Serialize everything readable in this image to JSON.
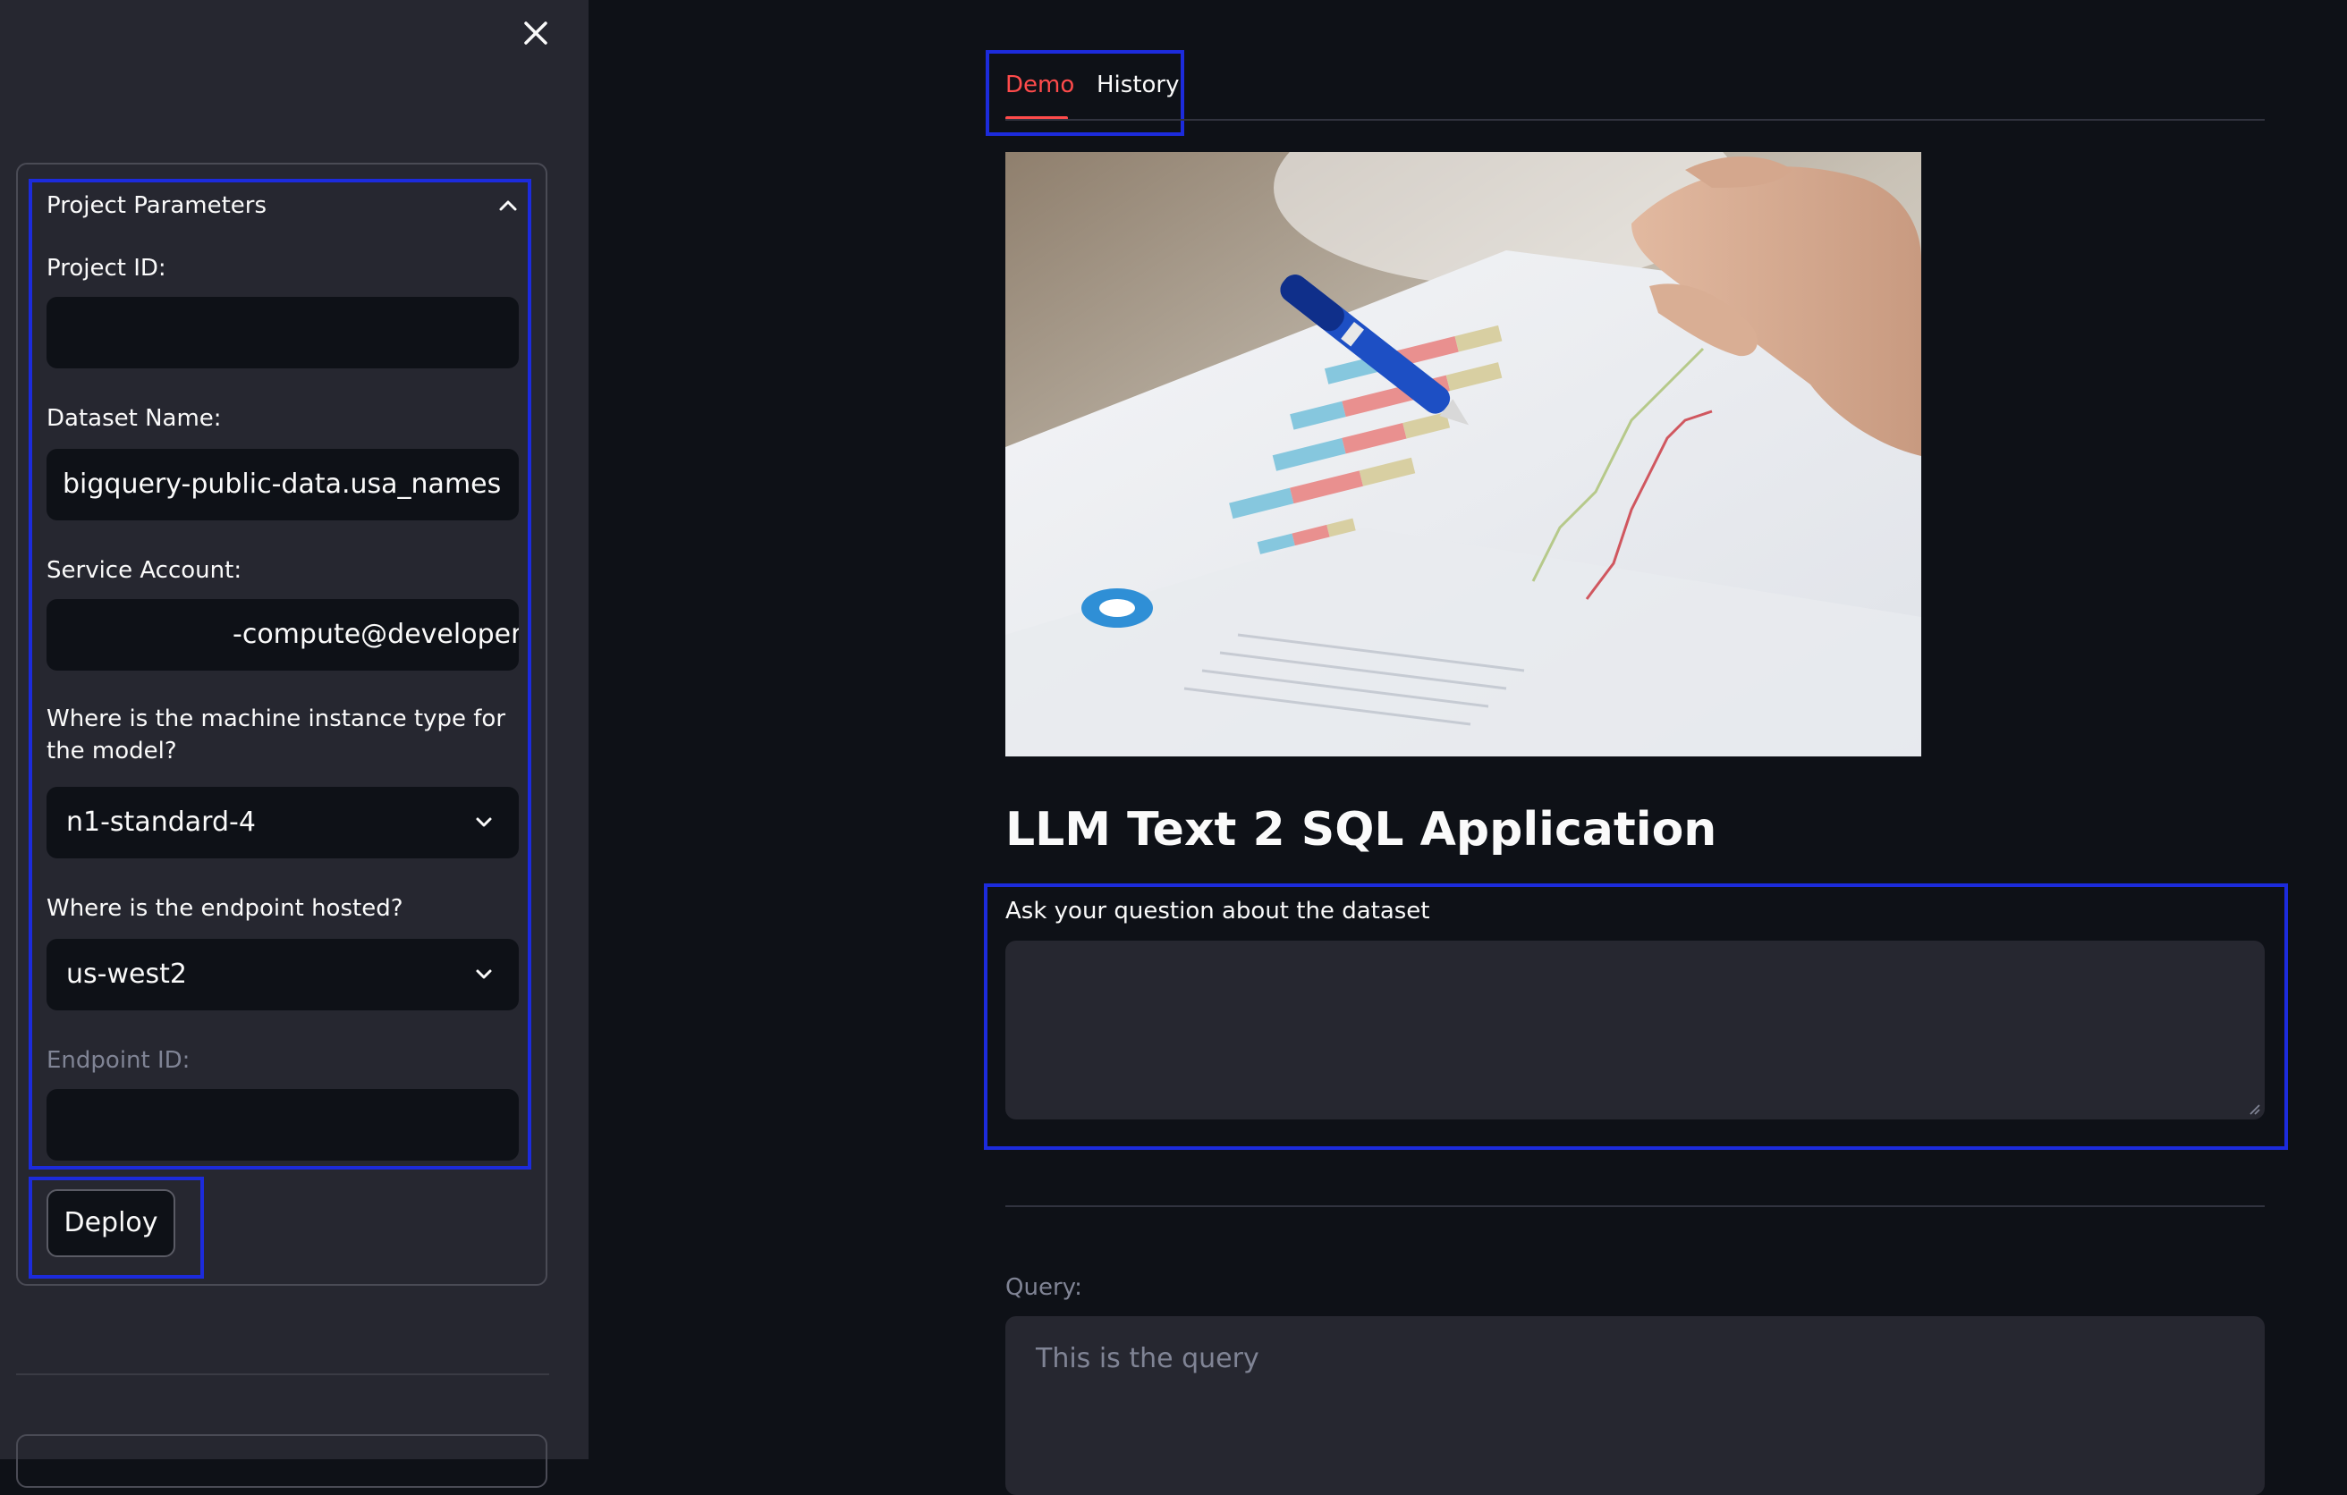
{
  "sidebar": {
    "expander_title": "Project Parameters",
    "project_id": {
      "label": "Project ID:",
      "value": ""
    },
    "dataset_name": {
      "label": "Dataset Name:",
      "value": "bigquery-public-data.usa_names"
    },
    "service_account": {
      "label": "Service Account:",
      "value": "-compute@developer.gserviceaccount.com"
    },
    "machine_type": {
      "label": "Where is the machine instance type for the model?",
      "value": "n1-standard-4"
    },
    "endpoint_region": {
      "label": "Where is the endpoint hosted?",
      "value": "us-west2"
    },
    "endpoint_id": {
      "label": "Endpoint ID:",
      "value": ""
    },
    "deploy_label": "Deploy"
  },
  "tabs": [
    {
      "label": "Demo",
      "active": true
    },
    {
      "label": "History",
      "active": false
    }
  ],
  "main": {
    "title": "LLM Text 2 SQL Application",
    "question_label": "Ask your question about the dataset",
    "question_value": "",
    "query_label": "Query:",
    "query_placeholder": "This is the query"
  },
  "colors": {
    "accent": "#ff4b4b",
    "highlight_box": "#1c2bdc",
    "background": "#0e1117",
    "sidebar": "#262730"
  }
}
